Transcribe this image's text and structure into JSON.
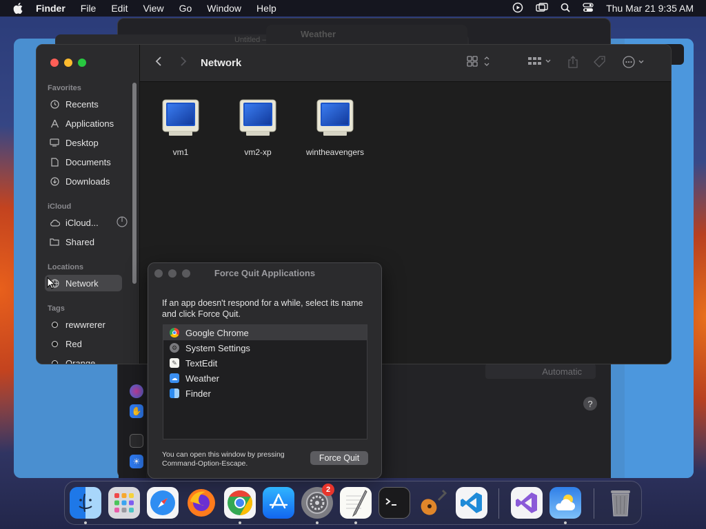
{
  "menubar": {
    "app_name": "Finder",
    "items": [
      "File",
      "Edit",
      "View",
      "Go",
      "Window",
      "Help"
    ],
    "clock": "Thu Mar 21  9:35 AM"
  },
  "background": {
    "weather_title": "Weather",
    "untitled_title": "Untitled — Edited",
    "automatic_label": "Automatic",
    "help_label": "?"
  },
  "finder": {
    "title": "Network",
    "sidebar": {
      "favorites_header": "Favorites",
      "favorites": [
        "Recents",
        "Applications",
        "Desktop",
        "Documents",
        "Downloads"
      ],
      "icloud_header": "iCloud",
      "icloud": [
        "iCloud...",
        "Shared"
      ],
      "locations_header": "Locations",
      "locations": [
        "Network"
      ],
      "tags_header": "Tags",
      "tags": [
        "rewwrerer",
        "Red",
        "Orange"
      ]
    },
    "items": [
      "vm1",
      "vm2-xp",
      "wintheavengers"
    ]
  },
  "force_quit": {
    "title": "Force Quit Applications",
    "description": "If an app doesn't respond for a while, select its name and click Force Quit.",
    "apps": [
      "Google Chrome",
      "System Settings",
      "TextEdit",
      "Weather",
      "Finder"
    ],
    "footer": "You can open this window by pressing Command-Option-Escape.",
    "button_label": "Force Quit"
  },
  "dock": {
    "apps": [
      "Finder",
      "Launchpad",
      "Safari",
      "Firefox",
      "Google Chrome",
      "App Store",
      "System Settings",
      "TextEdit",
      "Terminal",
      "GarageBand",
      "Visual Studio Code",
      "Visual Studio",
      "Weather",
      "Trash"
    ],
    "settings_badge": "2"
  }
}
